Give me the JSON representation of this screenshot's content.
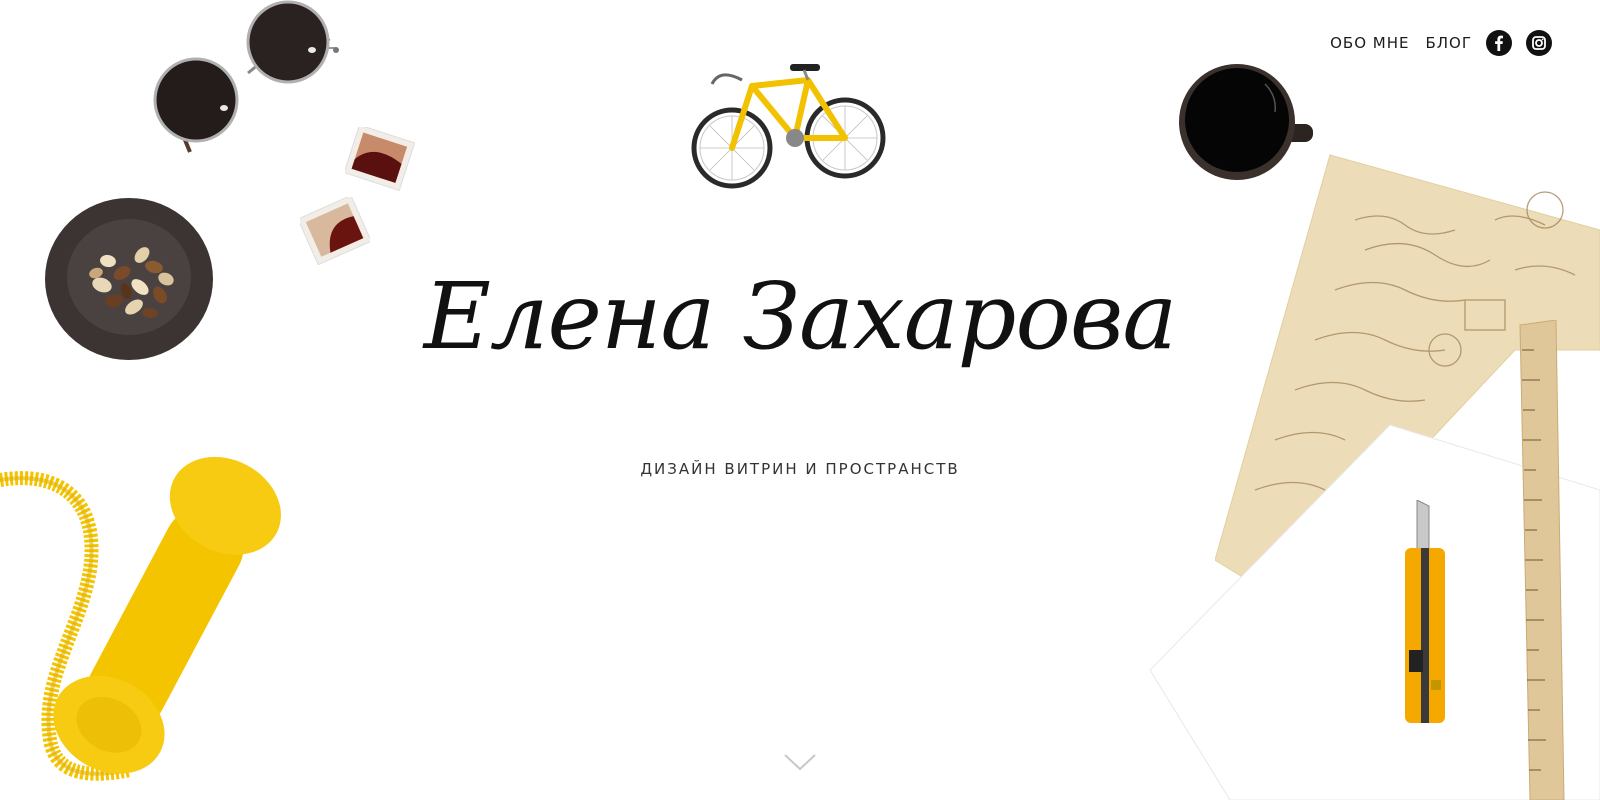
{
  "nav": {
    "about_label": "ОБО МНЕ",
    "blog_label": "БЛОГ",
    "facebook_icon": "facebook-icon",
    "instagram_icon": "instagram-icon"
  },
  "hero": {
    "title": "Елена Захарова",
    "subtitle": "ДИЗАЙН ВИТРИН И ПРОСТРАНСТВ"
  },
  "scroll_icon": "chevron-down-icon",
  "colors": {
    "accent_yellow": "#f5c400",
    "text": "#111111",
    "background": "#ffffff"
  }
}
